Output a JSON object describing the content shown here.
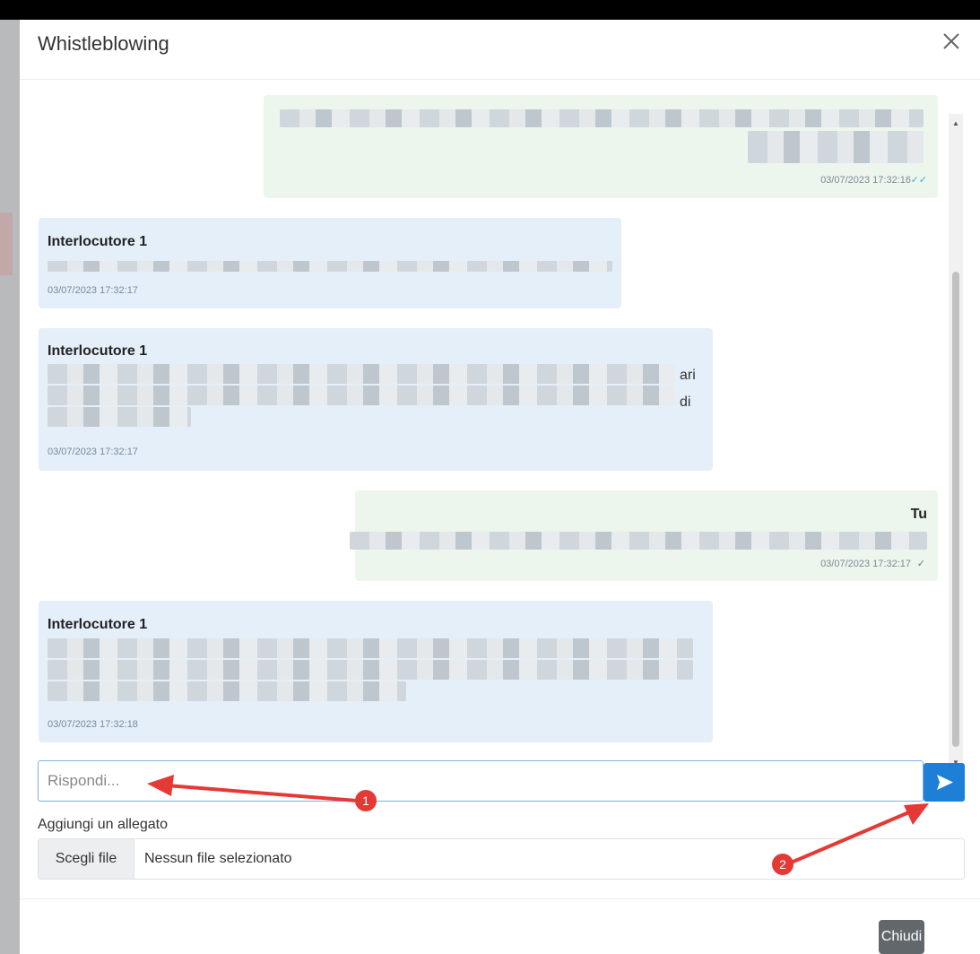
{
  "modal": {
    "title": "Whistleblowing"
  },
  "messages": [
    {
      "author": "",
      "timestamp": "03/07/2023 17:32:16",
      "direction": "out",
      "check": "double-check-icon",
      "fragments": []
    },
    {
      "author": "Interlocutore 1",
      "timestamp": "03/07/2023 17:32:17",
      "direction": "in",
      "fragments": []
    },
    {
      "author": "Interlocutore 1",
      "timestamp": "03/07/2023 17:32:17",
      "direction": "in",
      "fragments": [
        "ari",
        "di"
      ]
    },
    {
      "author": "Tu",
      "timestamp": "03/07/2023 17:32:17",
      "direction": "out",
      "check": "check-icon",
      "fragments": []
    },
    {
      "author": "Interlocutore 1",
      "timestamp": "03/07/2023 17:32:18",
      "direction": "in",
      "fragments": []
    }
  ],
  "reply": {
    "placeholder": "Rispondi..."
  },
  "attachment": {
    "label": "Aggiungi un allegato",
    "button": "Scegli file",
    "status": "Nessun file selezionato"
  },
  "footer": {
    "close_label": "Chiudi"
  },
  "annotations": [
    {
      "number": "1"
    },
    {
      "number": "2"
    }
  ],
  "colors": {
    "send_button": "#1d7fd6",
    "annotation_red": "#e53935",
    "incoming_bubble": "#e5eff9",
    "outgoing_bubble": "#edf6ec"
  }
}
